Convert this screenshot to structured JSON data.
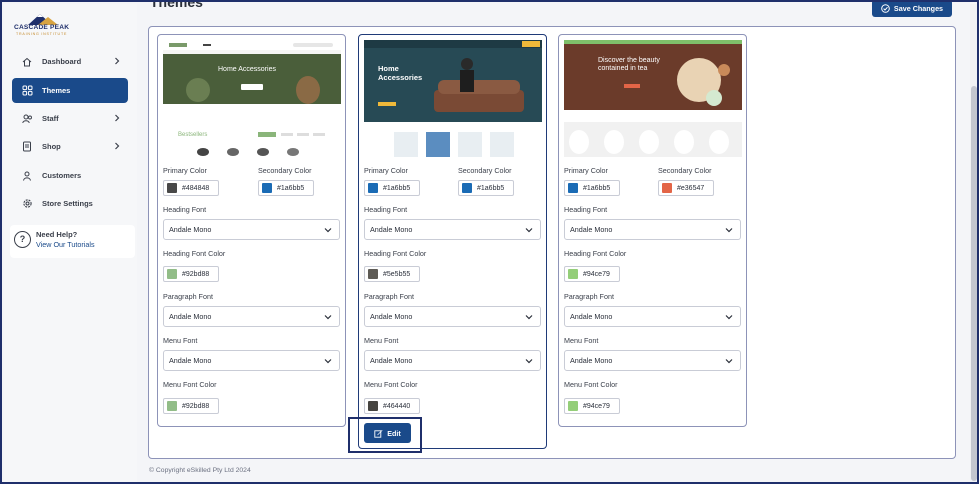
{
  "brand": {
    "name": "CASCADE PEAK",
    "tagline": "TRAINING INSTITUTE"
  },
  "page": {
    "title": "Themes",
    "save_label": "Save Changes",
    "copyright": "© Copyright eSkilled Pty Ltd 2024"
  },
  "sidebar": {
    "items": [
      {
        "label": "Dashboard",
        "icon": "dashboard-icon",
        "chevron": true
      },
      {
        "label": "Themes",
        "icon": "themes-icon",
        "chevron": false,
        "active": true
      },
      {
        "label": "Staff",
        "icon": "staff-icon",
        "chevron": true
      },
      {
        "label": "Shop",
        "icon": "shop-icon",
        "chevron": true
      },
      {
        "label": "Customers",
        "icon": "customers-icon",
        "chevron": false
      },
      {
        "label": "Store Settings",
        "icon": "settings-icon",
        "chevron": false
      }
    ],
    "help": {
      "title": "Need Help?",
      "link": "View Our Tutorials"
    }
  },
  "labels": {
    "primary_color": "Primary Color",
    "secondary_color": "Secondary Color",
    "heading_font": "Heading Font",
    "heading_font_color": "Heading Font Color",
    "paragraph_font": "Paragraph Font",
    "menu_font": "Menu Font",
    "menu_font_color": "Menu Font Color",
    "edit": "Edit"
  },
  "themes": [
    {
      "preview": {
        "headline": "Home Accessories",
        "section": "Bestsellers"
      },
      "primary_color": "#484848",
      "secondary_color": "#1a6bb5",
      "heading_font": "Andale Mono",
      "heading_font_color": "#92bd88",
      "paragraph_font": "Andale Mono",
      "menu_font": "Andale Mono",
      "menu_font_color": "#92bd88"
    },
    {
      "preview": {
        "headline_1": "Home",
        "headline_2": "Accessories"
      },
      "primary_color": "#1a6bb5",
      "secondary_color": "#1a6bb5",
      "heading_font": "Andale Mono",
      "heading_font_color": "#5e5b55",
      "paragraph_font": "Andale Mono",
      "menu_font": "Andale Mono",
      "menu_font_color": "#464440",
      "selected": true
    },
    {
      "preview": {
        "headline_1": "Discover the beauty",
        "headline_2": "contained in tea"
      },
      "primary_color": "#1a6bb5",
      "secondary_color": "#e36547",
      "heading_font": "Andale Mono",
      "heading_font_color": "#94ce79",
      "paragraph_font": "Andale Mono",
      "menu_font": "Andale Mono",
      "menu_font_color": "#94ce79"
    }
  ],
  "colors": {
    "accent": "#1a4a8a",
    "border": "#8d93b8"
  }
}
